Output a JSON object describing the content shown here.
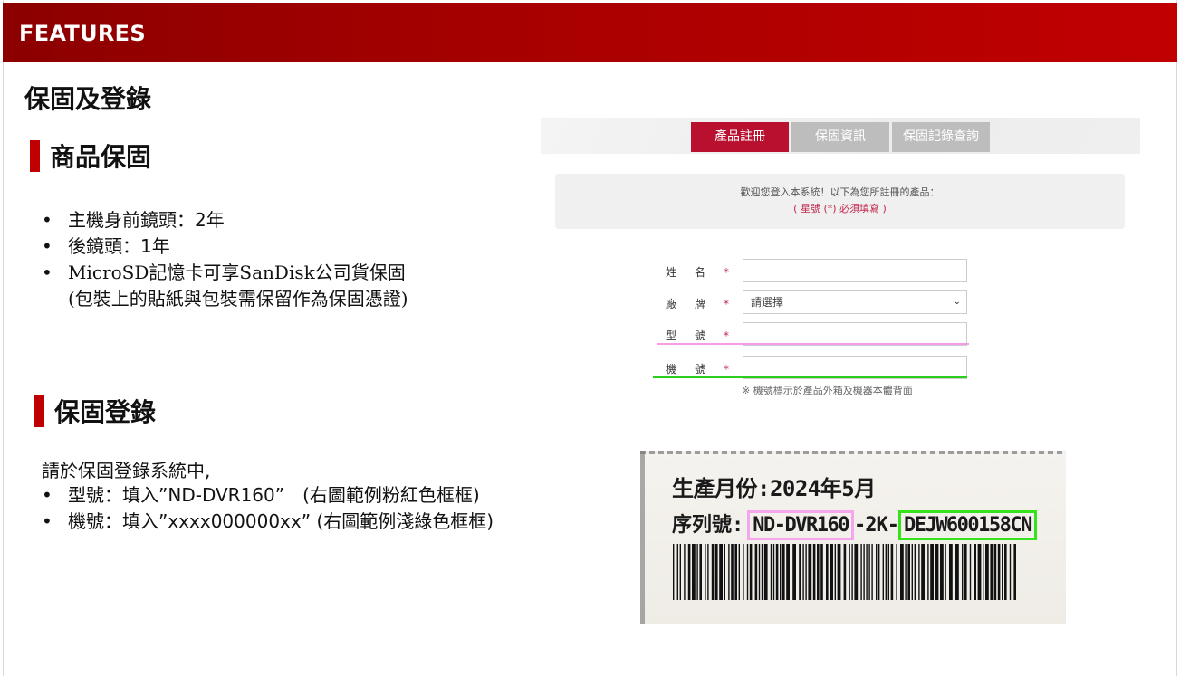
{
  "banner": {
    "title": "FEATURES"
  },
  "page_title": "保固及登錄",
  "warranty": {
    "heading": "商品保固",
    "items": [
      "主機身前鏡頭：2年",
      "後鏡頭：1年",
      "MicroSD記憶卡可享SanDisk公司貨保固",
      "(包裝上的貼紙與包裝需保留作為保固憑證)"
    ]
  },
  "registration": {
    "heading": "保固登錄",
    "intro": "請於保固登錄系統中,",
    "items": [
      "型號：填入”ND-DVR160”　(右圖範例粉紅色框框)",
      "機號：填入”xxxx000000xx” (右圖範例淺綠色框框)"
    ]
  },
  "form_screenshot": {
    "tabs": [
      "產品註冊",
      "保固資訊",
      "保固記錄查詢"
    ],
    "notice_line1": "歡迎您登入本系統！以下為您所註冊的產品：",
    "notice_line2": "( 星號 (*) 必須填寫 )",
    "fields": [
      {
        "label": "姓名",
        "star": "*"
      },
      {
        "label": "廠牌",
        "star": "*",
        "select_value": "請選擇"
      },
      {
        "label": "型號",
        "star": "*"
      },
      {
        "label": "機號",
        "star": "*"
      }
    ],
    "hint": "※ 機號標示於產品外箱及機器本體背面",
    "colors": {
      "tab_active": "#b8102e",
      "tab_inactive": "#bdbdbd",
      "pink_marker": "#f59be8",
      "green_marker": "#2bd01e"
    }
  },
  "label_photo": {
    "line1": "生產月份:2024年5月",
    "line2_prefix": "序列號:",
    "model": "ND-DVR160",
    "middle": "-2K-",
    "serial": "DEJW600158CN"
  },
  "colors": {
    "banner": "#a80000",
    "section_bar": "#c00000"
  }
}
